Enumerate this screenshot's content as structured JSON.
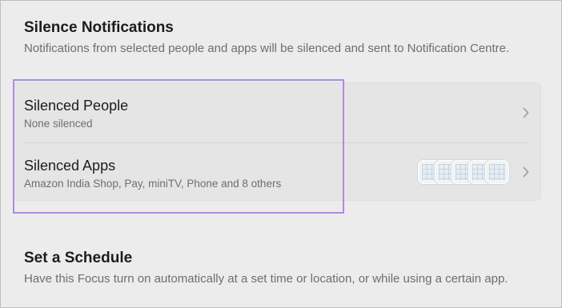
{
  "silence": {
    "title": "Silence Notifications",
    "description": "Notifications from selected people and apps will be silenced and sent to Notification Centre."
  },
  "silenced_people": {
    "title": "Silenced People",
    "subtitle": "None silenced",
    "chevron_icon": "chevron-right-icon"
  },
  "silenced_apps": {
    "title": "Silenced Apps",
    "subtitle": "Amazon India Shop, Pay, miniTV, Phone and 8 others",
    "app_icon_count": 5,
    "chevron_icon": "chevron-right-icon"
  },
  "schedule": {
    "title": "Set a Schedule",
    "description": "Have this Focus turn on automatically at a set time or location, or while using a certain app."
  },
  "colors": {
    "background": "#ececec",
    "card": "#e5e5e5",
    "highlight": "#b08ae3",
    "secondary_text": "#6e6e73"
  }
}
